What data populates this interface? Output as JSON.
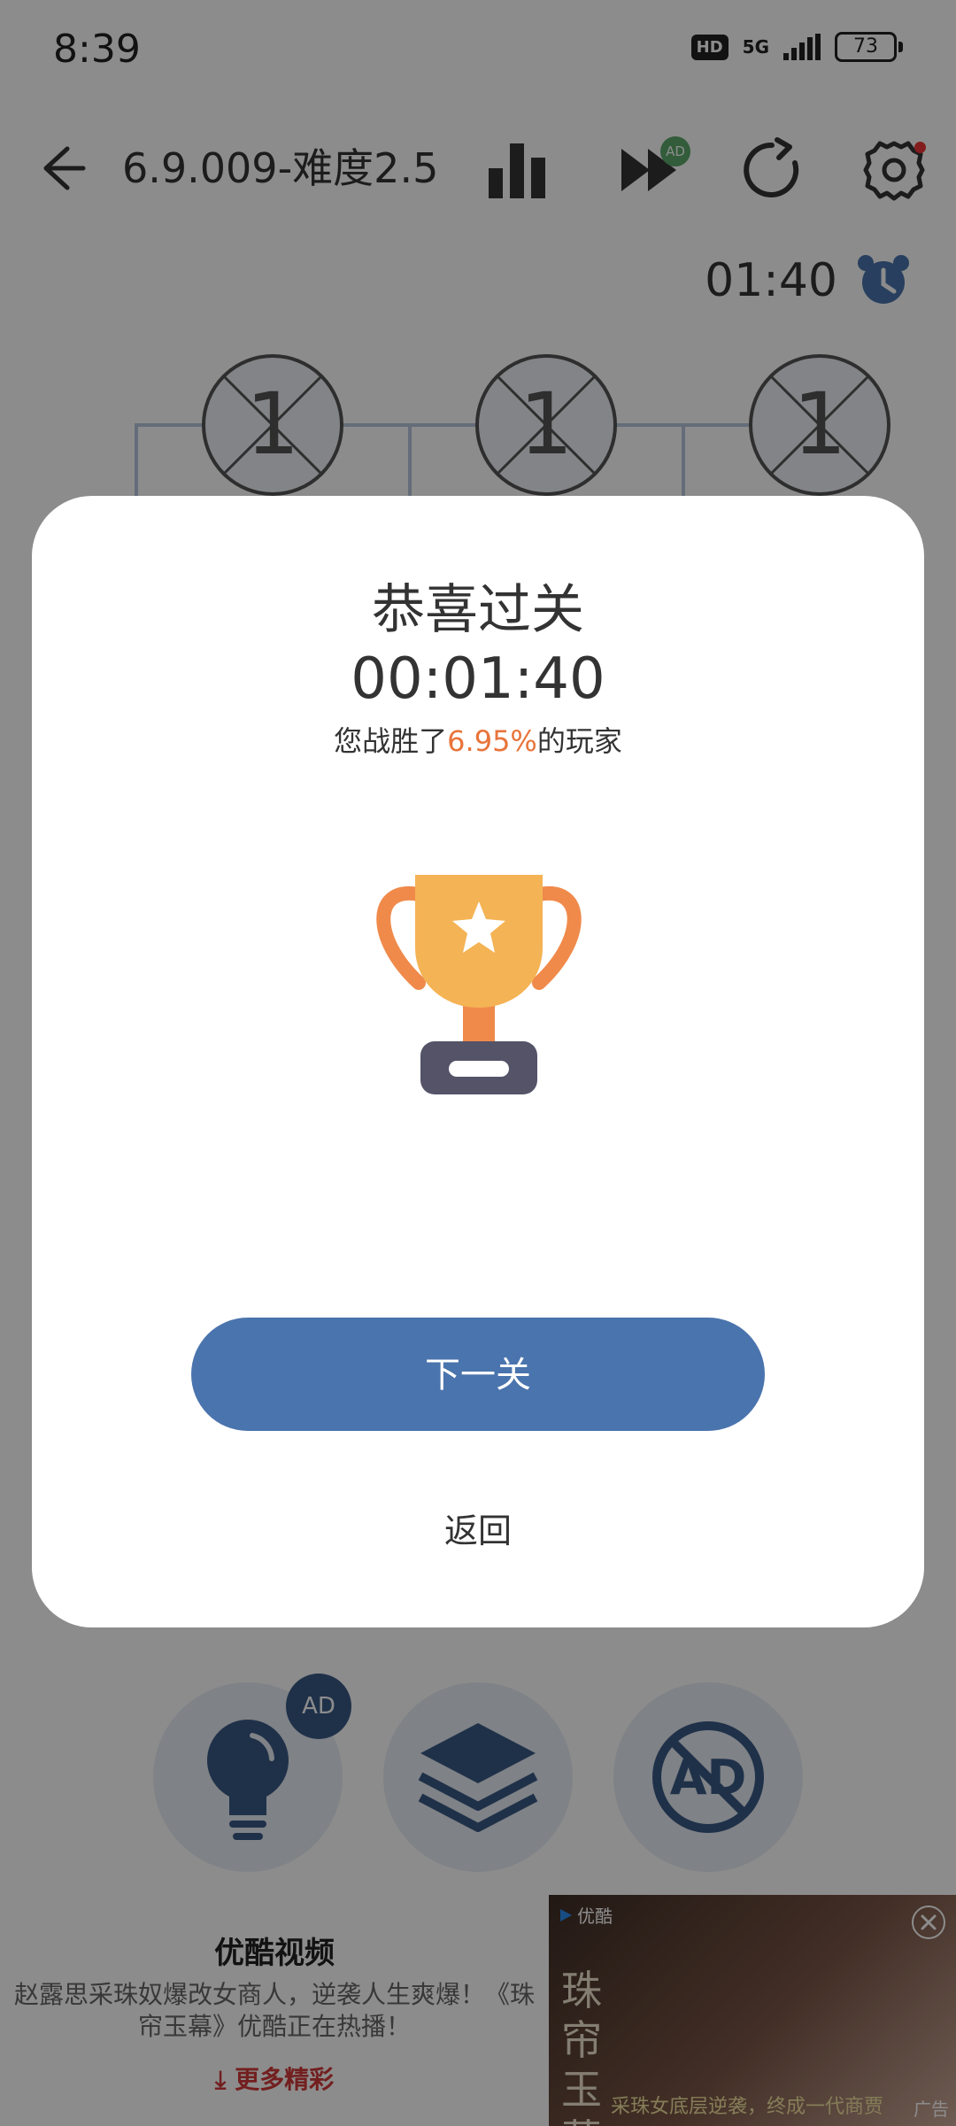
{
  "status_bar": {
    "time": "8:39",
    "hd": "HD",
    "network": "5G",
    "battery": "73"
  },
  "toolbar": {
    "title": "6.9.009-难度2.5",
    "ad_badge": "AD"
  },
  "timer": {
    "value": "01:40"
  },
  "grid": {
    "cells": [
      "1",
      "1",
      "1"
    ]
  },
  "helpers": {
    "hint_ad_badge": "AD"
  },
  "promo": {
    "title": "优酷视频",
    "description": "赵露思采珠奴爆改女商人，逆袭人生爽爆！《珠帘玉幕》优酷正在热播！",
    "more": "更多精彩"
  },
  "ad_banner": {
    "brand": "优酷",
    "label": "广告",
    "caption": "采珠女底层逆袭，终成一代商贾",
    "vertical_title": "珠帘玉幕"
  },
  "dialog": {
    "title": "恭喜过关",
    "time": "00:01:40",
    "stats_prefix": "您战胜了",
    "stats_percent": "6.95%",
    "stats_suffix": "的玩家",
    "next_label": "下一关",
    "back_label": "返回"
  },
  "colors": {
    "primary_button": "#4a74ad",
    "percent_highlight": "#e8743b",
    "trophy_cup": "#f4b354",
    "trophy_handles": "#f08a4b",
    "trophy_base": "#545368",
    "more_link": "#d23a3a"
  },
  "icons": [
    "back-arrow-icon",
    "stats-bars-icon",
    "fast-forward-icon",
    "refresh-icon",
    "settings-icon",
    "alarm-clock-icon",
    "lightbulb-icon",
    "layers-icon",
    "no-ad-icon",
    "trophy-icon",
    "close-icon",
    "download-arrow-icon"
  ]
}
